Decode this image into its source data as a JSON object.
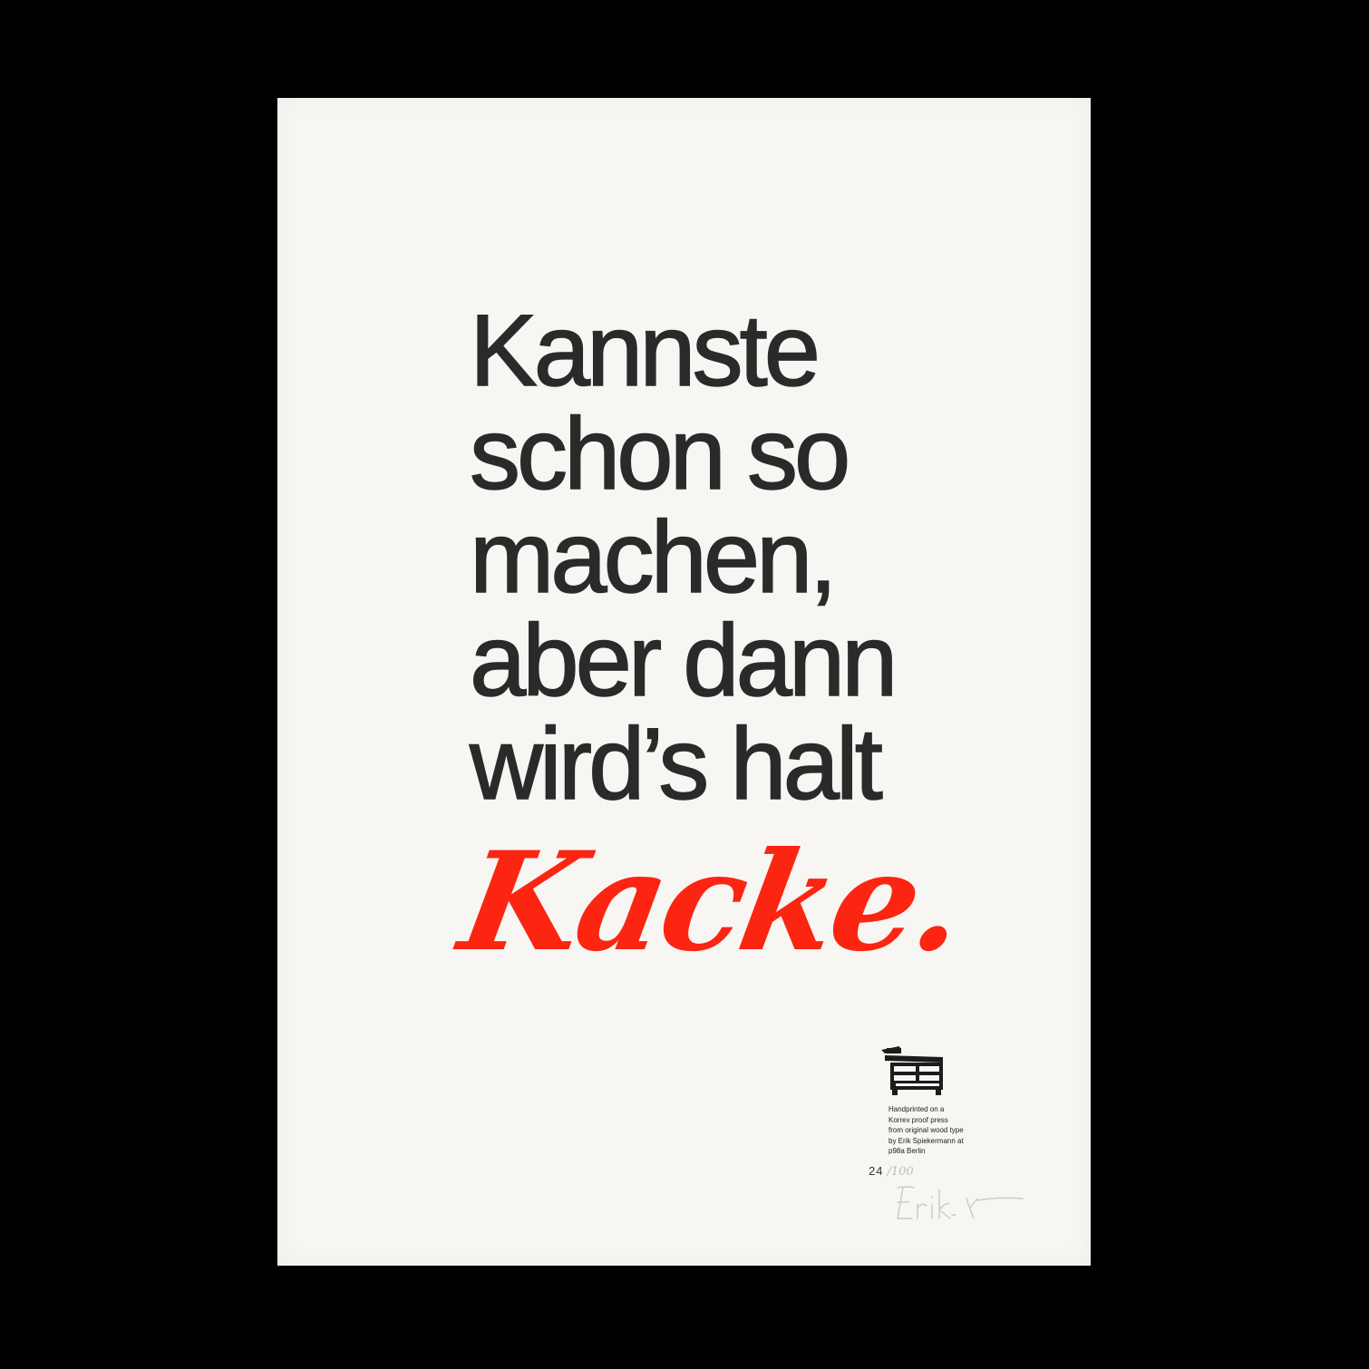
{
  "poster": {
    "headline_lines": [
      "Kannste",
      "schon so",
      "machen,",
      "aber dann",
      "wird’s halt"
    ],
    "accent_word": "Kacke.",
    "colophon_lines": [
      "Handprinted on a",
      "Korrex proof press",
      "from original wood type",
      "by Erik Spiekermann at",
      "p98a Berlin"
    ],
    "edition_number": "24",
    "edition_total": "/100",
    "signature": "Erik S."
  },
  "colors": {
    "background": "#000000",
    "paper": "#f7f6f3",
    "ink_black": "#2a2a2a",
    "ink_red": "#fb2512"
  }
}
